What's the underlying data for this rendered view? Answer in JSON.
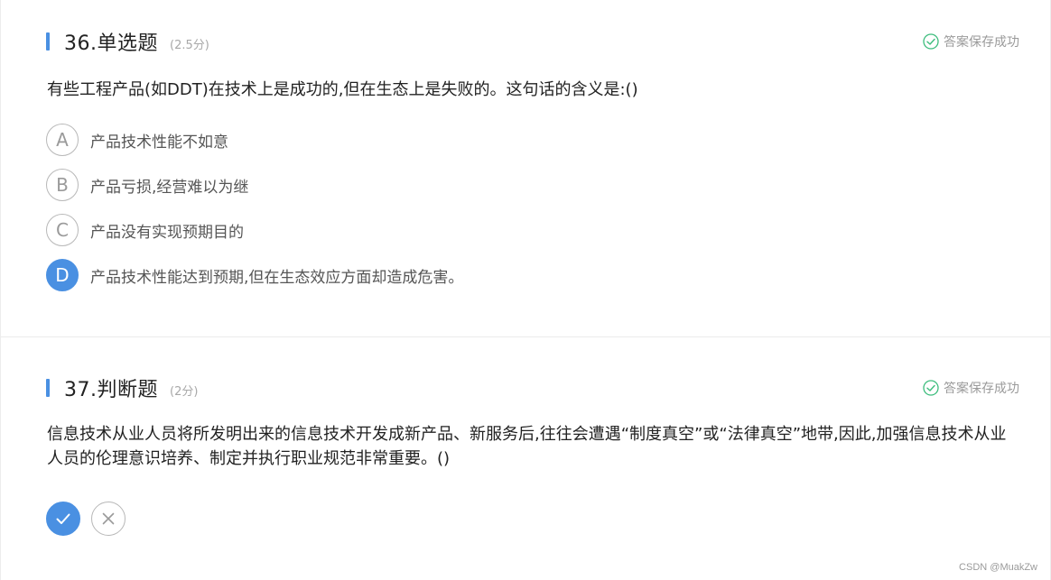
{
  "questions": [
    {
      "number_title": "36.单选题",
      "score": "(2.5分)",
      "save_status": "答案保存成功",
      "stem": "有些工程产品(如DDT)在技术上是成功的,但在生态上是失败的。这句话的含义是:()",
      "options": [
        {
          "letter": "A",
          "text": "产品技术性能不如意",
          "selected": false
        },
        {
          "letter": "B",
          "text": "产品亏损,经营难以为继",
          "selected": false
        },
        {
          "letter": "C",
          "text": "产品没有实现预期目的",
          "selected": false
        },
        {
          "letter": "D",
          "text": "产品技术性能达到预期,但在生态效应方面却造成危害。",
          "selected": true
        }
      ]
    },
    {
      "number_title": "37.判断题",
      "score": "(2分)",
      "save_status": "答案保存成功",
      "stem": "信息技术从业人员将所发明出来的信息技术开发成新产品、新服务后,往往会遭遇“制度真空”或“法律真空”地带,因此,加强信息技术从业人员的伦理意识培养、制定并执行职业规范非常重要。()",
      "true_false": {
        "true_icon": "check-icon",
        "false_icon": "cross-icon",
        "selected": "true"
      }
    }
  ],
  "watermark": "CSDN @MuakZw",
  "colors": {
    "accent": "#4a90e2",
    "success": "#3dbd7d",
    "muted": "#9a9a9a"
  }
}
